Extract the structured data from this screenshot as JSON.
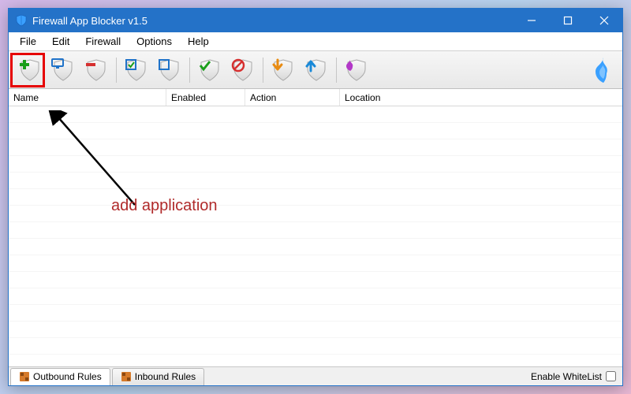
{
  "titlebar": {
    "title": "Firewall App Blocker v1.5"
  },
  "menubar": {
    "items": [
      "File",
      "Edit",
      "Firewall",
      "Options",
      "Help"
    ]
  },
  "toolbar": {
    "add": "Add Application",
    "process": "Add Process",
    "remove": "Remove",
    "enable": "Enable Rule",
    "disable": "Disable Rule",
    "allow": "Allow",
    "block": "Block",
    "import": "Import",
    "export": "Export",
    "flame": "Firewall"
  },
  "columns": {
    "name": "Name",
    "enabled": "Enabled",
    "action": "Action",
    "location": "Location"
  },
  "annotation": {
    "text": "add application"
  },
  "statusbar": {
    "tab_outbound": "Outbound Rules",
    "tab_inbound": "Inbound Rules",
    "whitelist_label": "Enable WhiteList"
  }
}
